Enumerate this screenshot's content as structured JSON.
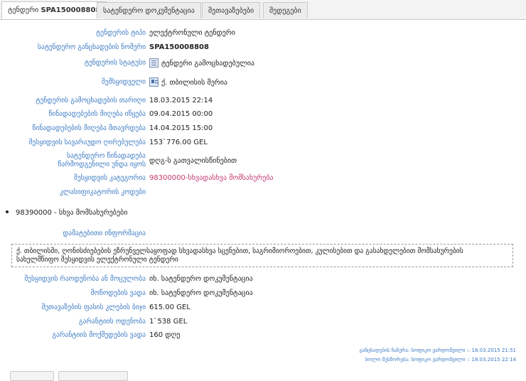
{
  "tabs": [
    {
      "label_prefix": "ტენდერი",
      "label_bold": "SPA150008808"
    },
    {
      "label": "სატენდერო დოკუმენტაცია"
    },
    {
      "label": "შეთავაზებები"
    },
    {
      "label": "შედეგები"
    }
  ],
  "fields": {
    "tender_type": {
      "label": "ტენდერის ტიპი",
      "value": "ელექტრონული ტენდერი"
    },
    "announcement_number": {
      "label": "სატენდერო განცხადების ნომერი",
      "value": "SPA150008808"
    },
    "tender_status": {
      "label": "ტენდერის სტატუსი",
      "value": "ტენდერი გამოცხადებულია",
      "icon": "document-status-icon"
    },
    "buyer": {
      "label": "შემსყიდველი",
      "value": "ქ. თბილისის მერია",
      "icon": "organization-card-icon"
    },
    "announce_date": {
      "label": "ტენდერის გამოცხადების თარიღი",
      "value": "18.03.2015 22:14"
    },
    "bids_start": {
      "label": "წინადადებების მიღება იწყება",
      "value": "09.04.2015 00:00"
    },
    "bids_end": {
      "label": "წინადადებების მიღება მთავრდება",
      "value": "14.04.2015 15:00"
    },
    "estimated_value": {
      "label": "შესყიდვის სავარაუდო ღირებულება",
      "value": "153`776.00 GEL"
    },
    "bid_includes_line1": {
      "label": "სატენდერო წინადადება",
      "value": "დღგ-ს გათვალისწინებით"
    },
    "bid_includes_line2": {
      "label": "წარმოდგენილი უნდა იყოს"
    },
    "category": {
      "label": "შესყიდვის კატეგორია",
      "value": "98300000-სხვადასხვა მომსახურება"
    },
    "classifier_codes": {
      "label": "კლასიფიკატორის კოდები"
    }
  },
  "classifier_items": [
    "98390000 - სხვა მომსახურებები"
  ],
  "additional_info": {
    "label": "დამატებითი ინფორმაცია",
    "text_line1": "ქ. თბილისში, ღონისძიებების ეზრუნველსაყოფად სხვადასხვა სცენებით, საგრიმიოროებით, კულისებით და გასახდელებით მომსახურების",
    "text_line2": "სახელმწიფო შესყიდვის ელექტრონული ტენდერი"
  },
  "fields2": {
    "quantity": {
      "label": "შესყიდვის რაოდენობა ან მოცულობა",
      "value": "იხ. სატენდერო დოკუმენტაცია"
    },
    "delivery_term": {
      "label": "მოწოდების ვადა",
      "value": "იხ. სატენდერო დოკუმენტაცია"
    },
    "price_step": {
      "label": "შეთავაზების ფასის კლების ბიჯი",
      "value": "615.00 GEL"
    },
    "guarantee_amount": {
      "label": "გარანტიის ოდენობა",
      "value": "1`538 GEL"
    },
    "guarantee_term": {
      "label": "გარანტიის მოქმედების ვადა",
      "value": "160 დღე"
    }
  },
  "footer": {
    "line1": "განცხადების ჩანერა: სოფიკო ვარდოშვილი :: 18.03.2015 21:51",
    "line2": "ბოლო შესწორება: სოფიკო ვარდოშვილი :: 18.03.2015 22:14"
  },
  "colors": {
    "label": "#3e7cc4",
    "category": "#c2386f",
    "tab_border": "#c9c9c9"
  }
}
